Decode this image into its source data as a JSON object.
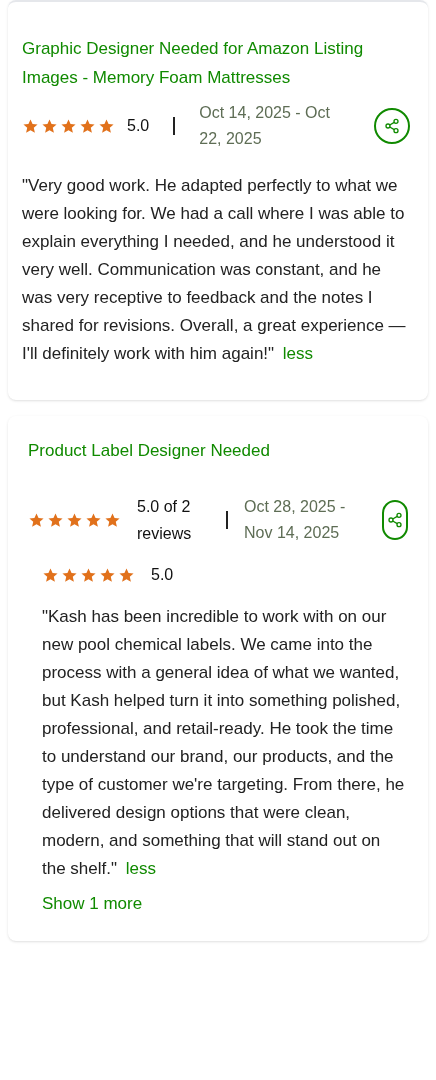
{
  "reviews": [
    {
      "title": "Graphic Designer Needed for Amazon Listing Images - Memory Foam Mattresses",
      "stars": 5,
      "rating": "5.0",
      "dates": "Oct 14, 2025 - Oct 22, 2025",
      "review": "\"Very good work. He adapted perfectly to what we were looking for. We had a call where I was able to explain everything I needed, and he understood it very well. Communication was constant, and he was very receptive to feedback and the notes I shared for revisions. Overall, a great experience — I'll definitely work with him again!\"",
      "less": "less"
    },
    {
      "title": "Product Label Designer Needed",
      "stars": 5,
      "rating": "5.0 of 2 reviews",
      "dates": "Oct 28, 2025 - Nov 14, 2025",
      "sub_review": {
        "stars": 5,
        "rating": "5.0",
        "review": "\"Kash has been incredible to work with on our new pool chemical labels. We came into the process with a general idea of what we wanted, but Kash helped turn it into something polished, professional, and retail-ready. He took the time to understand our brand, our products, and the type of customer we're targeting. From there, he delivered design options that were clean, modern, and something that will stand out on the shelf.\"",
        "less": "less"
      },
      "show_more": "Show 1 more"
    }
  ]
}
